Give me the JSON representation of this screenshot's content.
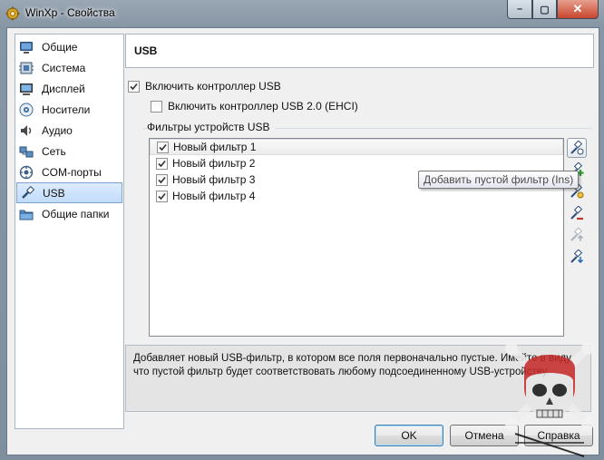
{
  "window": {
    "title": "WinXp - Свойства",
    "close_glyph": "✕",
    "min_glyph": "–",
    "max_glyph": "▢"
  },
  "nav": {
    "items": [
      {
        "label": "Общие",
        "icon": "general-icon"
      },
      {
        "label": "Система",
        "icon": "system-icon"
      },
      {
        "label": "Дисплей",
        "icon": "display-icon"
      },
      {
        "label": "Носители",
        "icon": "storage-icon"
      },
      {
        "label": "Аудио",
        "icon": "audio-icon"
      },
      {
        "label": "Сеть",
        "icon": "network-icon"
      },
      {
        "label": "COM-порты",
        "icon": "com-ports-icon"
      },
      {
        "label": "USB",
        "icon": "usb-icon",
        "selected": true
      },
      {
        "label": "Общие папки",
        "icon": "shared-folders-icon"
      }
    ]
  },
  "page": {
    "title": "USB",
    "enable_usb": {
      "label": "Включить контроллер USB",
      "checked": true
    },
    "enable_ehci": {
      "label": "Включить контроллер USB 2.0 (EHCI)",
      "checked": false
    },
    "filters_group_label": "Фильтры устройств USB",
    "filters": [
      {
        "label": "Новый фильтр 1",
        "checked": true,
        "selected": true
      },
      {
        "label": "Новый фильтр 2",
        "checked": true
      },
      {
        "label": "Новый фильтр 3",
        "checked": true
      },
      {
        "label": "Новый фильтр 4",
        "checked": true
      }
    ],
    "tools": [
      "add-empty-filter-icon",
      "add-filter-from-device-icon",
      "edit-filter-icon",
      "remove-filter-icon",
      "move-filter-up-icon",
      "move-filter-down-icon"
    ],
    "tooltip": "Добавить пустой фильтр (Ins)",
    "description": "Добавляет новый USB-фильтр, в котором все поля первоначально пустые. Имейте в виду, что пустой фильтр будет соответствовать любому подсоединенному USB-устройству."
  },
  "buttons": {
    "ok": "OK",
    "cancel": "Отмена",
    "help": "Справка"
  },
  "colors": {
    "accent": "#3c7fb1",
    "selection": "#c1dcfc"
  }
}
